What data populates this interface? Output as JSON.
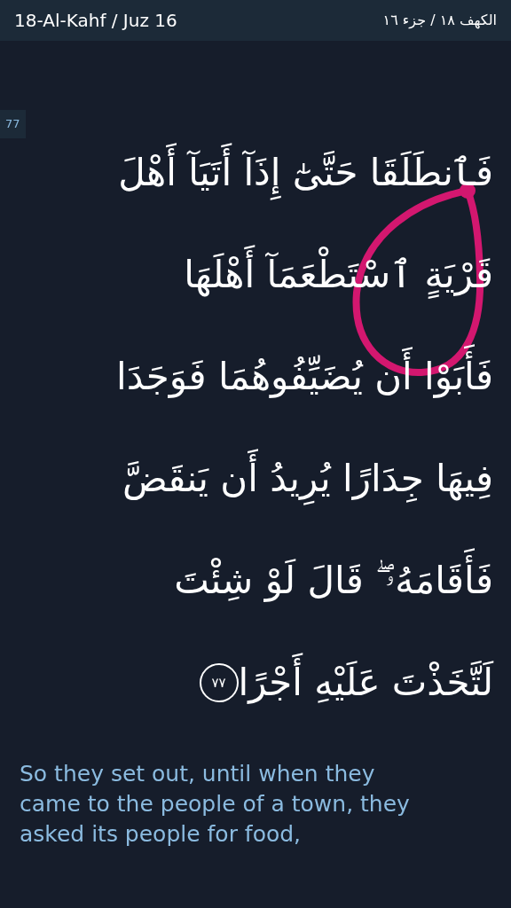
{
  "header": {
    "title": "18-Al-Kahf / Juz 16",
    "title_arabic": "الكهف ١٨ / جزء ١٦"
  },
  "verse": {
    "number": "77",
    "lines": [
      "فَٱنطَلَقَا حَتَّىٰٓ إِذَآ أَتَيَآ أَهْلَ",
      "قَرْيَةٍ ٱسْتَطْعَمَآ أَهْلَهَا",
      "فَأَبَوْا أَن يُضَيِّفُوهُمَا فَوَجَدَا",
      "فِيهَا جِدَارًا يُرِيدُ أَن يَنقَضَّ",
      "فَأَقَامَهُۥ ۖ قَالَ لَوْ شِئْتَ",
      "لَتَّخَذْتَ عَلَيْهِ أَجْرًا"
    ],
    "end_marker": "٧٧",
    "translation": "So they set out, until when they came to the people of a town, they asked its people for food,"
  }
}
